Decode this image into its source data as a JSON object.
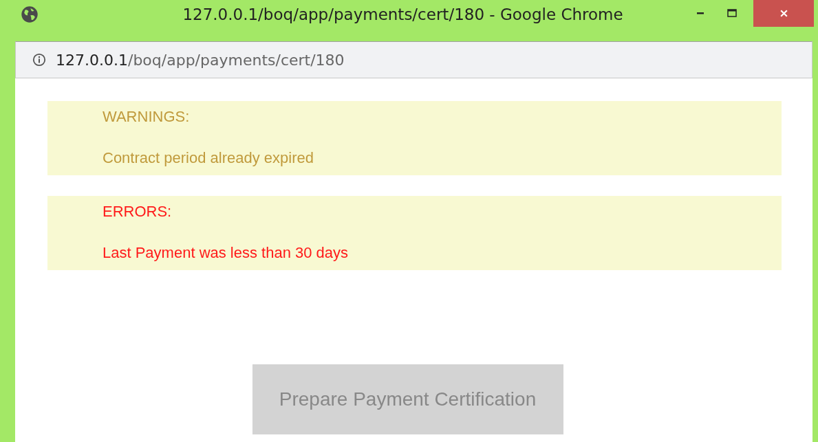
{
  "window": {
    "title": "127.0.0.1/boq/app/payments/cert/180 - Google Chrome"
  },
  "address_bar": {
    "host": "127.0.0.1",
    "path": "/boq/app/payments/cert/180"
  },
  "messages": [
    {
      "kind": "warning",
      "heading": "WARNINGS:",
      "text": "Contract period already expired"
    },
    {
      "kind": "error",
      "heading": "ERRORS:",
      "text": "Last Payment was less than 30 days"
    }
  ],
  "button": {
    "label": "Prepare Payment Certification",
    "disabled": true
  }
}
